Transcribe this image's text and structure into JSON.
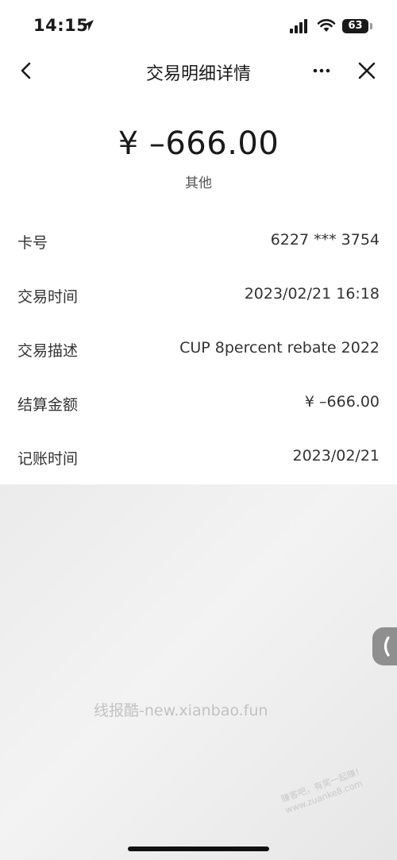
{
  "status_bar": {
    "time": "14:15",
    "battery_level": "63",
    "icons": [
      "location-arrow-icon",
      "cellular-signal-icon",
      "wifi-icon",
      "battery-icon"
    ]
  },
  "nav": {
    "title": "交易明细详情",
    "back_icon": "chevron-left-icon",
    "more_icon": "more-dots-icon",
    "close_icon": "close-icon"
  },
  "amount": {
    "value": "¥ –666.00",
    "category": "其他"
  },
  "details": [
    {
      "label": "卡号",
      "value": "6227 *** 3754"
    },
    {
      "label": "交易时间",
      "value": "2023/02/21 16:18"
    },
    {
      "label": "交易描述",
      "value": "CUP 8percent rebate 2022"
    },
    {
      "label": "结算金额",
      "value": "¥ –666.00"
    },
    {
      "label": "记账时间",
      "value": "2023/02/21"
    }
  ],
  "watermarks": {
    "main": "线报酷-new.xianbao.fun",
    "corner_line1": "赚客吧，有奖一起赚！",
    "corner_line2": "www.zuanke8.com"
  },
  "colors": {
    "background": "#ffffff",
    "grey_area": "#ececec",
    "text_primary": "#1a1a1a",
    "text_secondary": "#555555"
  }
}
